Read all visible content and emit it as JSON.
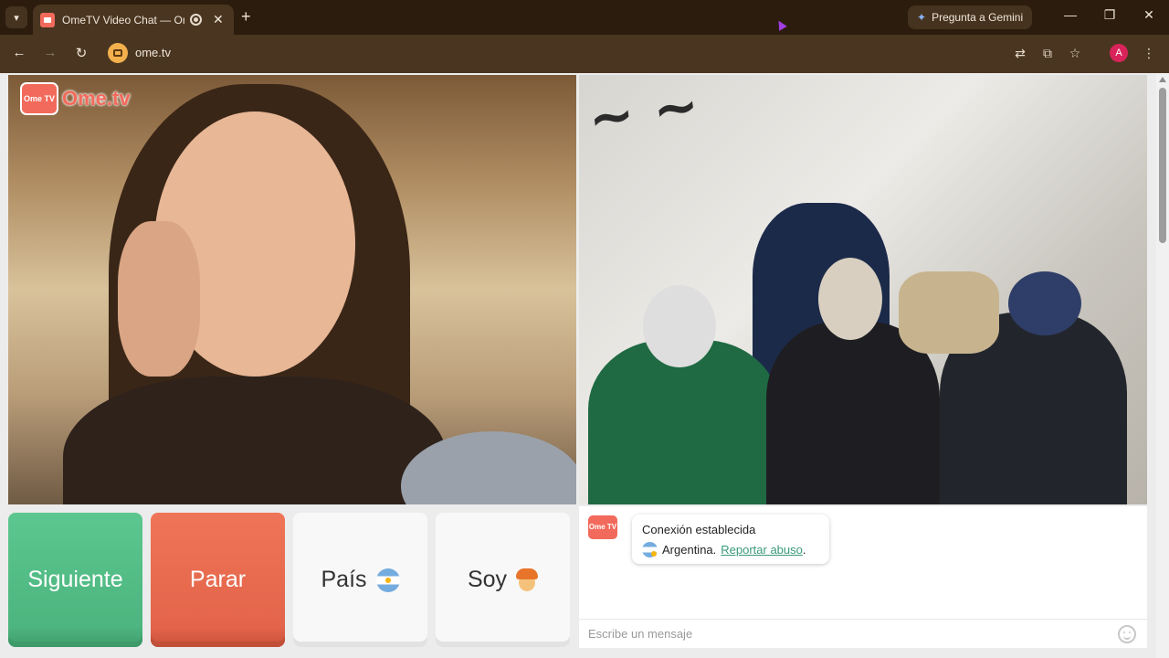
{
  "browser": {
    "tab_title": "OmeTV Video Chat — Ome",
    "new_tab_symbol": "+",
    "gemini_label": "Pregunta a Gemini",
    "url": "ome.tv",
    "profile_initial": "A",
    "close_symbol": "✕"
  },
  "logo": {
    "icon_text": "Ome TV",
    "text": "Ome.tv"
  },
  "controls": {
    "next_label": "Siguiente",
    "stop_label": "Parar",
    "country_label": "País",
    "gender_label": "Soy"
  },
  "chat": {
    "logo_text": "Ome TV",
    "status": "Conexión establecida",
    "country": "Argentina.",
    "report_link": "Reportar abuso",
    "report_suffix": ".",
    "input_placeholder": "Escribe un mensaje"
  },
  "colors": {
    "next_button": "#5cc790",
    "stop_button": "#ef7558",
    "link": "#3a9a78",
    "brand": "#f26a5b"
  },
  "icons": {
    "tab_search": "chevron-down-icon",
    "back": "arrow-left-icon",
    "forward": "arrow-right-icon",
    "reload": "reload-icon",
    "translate": "translate-icon",
    "cast": "install-icon",
    "bookmark": "star-icon",
    "menu": "kebab-menu-icon",
    "emoji": "smile-icon"
  }
}
